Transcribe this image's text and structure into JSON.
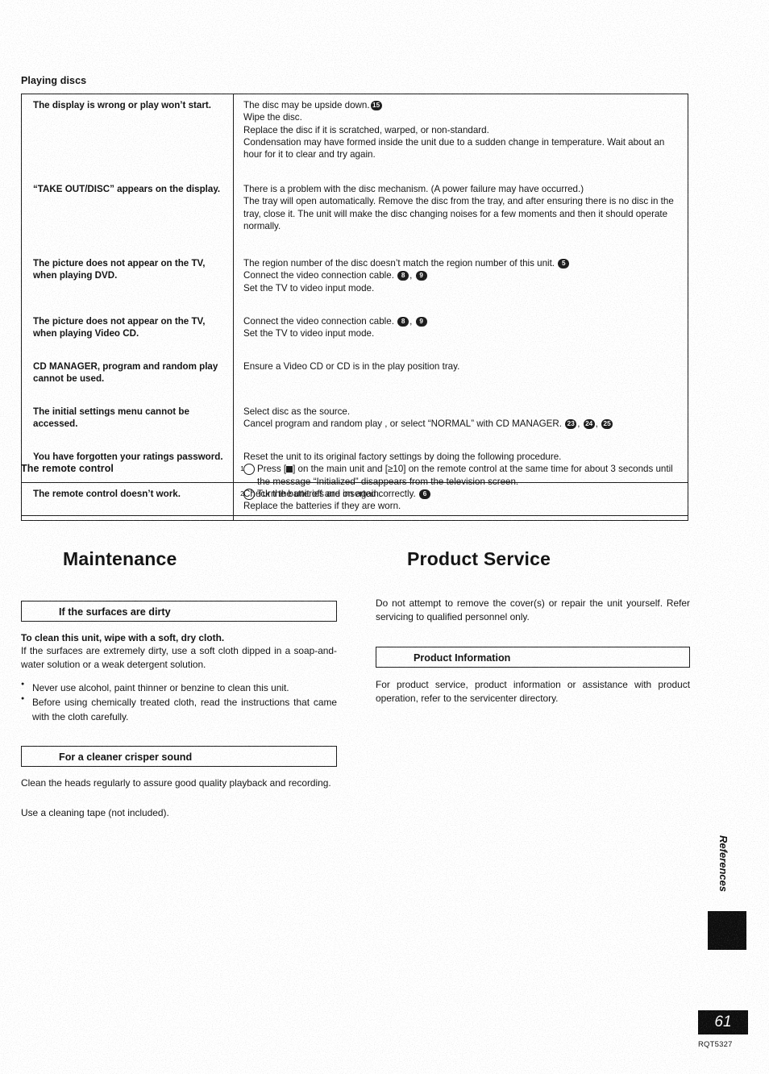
{
  "document": {
    "page_number": "61",
    "doc_code": "RQT5327",
    "side_tab_label": "References"
  },
  "troubleshooting": {
    "playing_discs": {
      "heading": "Playing discs",
      "rows": [
        {
          "symptom": "The display is wrong or play won’t start.",
          "remedies": [
            {
              "text": "The disc may be upside down.",
              "ref": "15"
            },
            {
              "text": "Wipe the disc."
            },
            {
              "text": "Replace the disc if it is scratched, warped, or non-standard."
            },
            {
              "text": "Condensation may have formed inside the unit due to a sudden change in temperature. Wait about an hour for it to clear and try again."
            }
          ]
        },
        {
          "symptom": "“TAKE OUT/DISC” appears on the display.",
          "remedies": [
            {
              "text": "There is a problem with the disc mechanism. (A power failure may have occurred.)"
            },
            {
              "text": "The tray will open automatically. Remove the disc from the tray, and after ensuring there is no disc in the tray, close it. The unit will make the disc changing noises for a few moments and then it should operate normally."
            }
          ]
        },
        {
          "symptom": "The picture does not appear on the TV, when playing DVD.",
          "remedies": [
            {
              "text": "The region number of the disc doesn’t match the region number of this unit.",
              "ref": "5",
              "underline": true
            },
            {
              "text": "Connect the video connection cable.",
              "ref": "8",
              "ref2": "9"
            },
            {
              "text": "Set the TV to video input mode."
            }
          ]
        },
        {
          "symptom": "The picture does not appear on the TV, when playing Video CD.",
          "remedies": [
            {
              "text": "Connect the video connection cable.",
              "ref": "8",
              "ref2": "9"
            },
            {
              "text": "Set the TV to video input mode."
            }
          ]
        },
        {
          "symptom": "CD MANAGER, program and random play cannot be used.",
          "remedies": [
            {
              "text": "Ensure a Video CD or CD is in the play position tray."
            }
          ]
        },
        {
          "symptom": "The initial settings menu cannot be accessed.",
          "remedies": [
            {
              "text": "Select disc as the source."
            },
            {
              "text": "Cancel program  and random play , or select “NORMAL” with CD MANAGER.",
              "ref": "23",
              "ref2": "24",
              "ref3": "25"
            }
          ]
        },
        {
          "symptom": "You have forgotten your ratings password.",
          "remedies": [
            {
              "text": "Reset the unit to its original factory settings by doing the following procedure."
            },
            {
              "num": "1",
              "text_before": "Press [",
              "key": "square-stop",
              "text_after": "] on the main unit and [≥10] on the remote control at the same time for about 3 seconds until the message “Initialized” disappears from the television screen."
            },
            {
              "num": "2",
              "text": "Turn the unit off and on again."
            }
          ]
        }
      ]
    },
    "remote_control": {
      "heading": "The remote control",
      "rows": [
        {
          "symptom": "The remote control doesn’t work.",
          "remedies": [
            {
              "text": "Check the batteries are inserted correctly.",
              "ref": "6"
            },
            {
              "text": "Replace the batteries if they are worn."
            }
          ]
        }
      ]
    }
  },
  "maintenance": {
    "title": "Maintenance",
    "sections": [
      {
        "box_title": "If the surfaces are dirty",
        "lead": "To clean this unit, wipe with a soft, dry cloth.",
        "body": "If the surfaces are extremely dirty, use a soft cloth dipped in a soap-and-water solution or a weak detergent solution.",
        "bullets": [
          "Never use alcohol, paint thinner or benzine to clean this unit.",
          "Before using chemically treated cloth, read the instructions that came with the cloth carefully."
        ]
      },
      {
        "box_title": "For a cleaner crisper sound",
        "body_lines": [
          "Clean the heads regularly to assure good quality playback and recording.",
          "Use a cleaning tape (not included)."
        ]
      }
    ]
  },
  "product_service": {
    "title": "Product Service",
    "intro": "Do not attempt to remove the cover(s) or repair the unit yourself. Refer servicing to qualified personnel only.",
    "box_title": "Product Information",
    "body": "For product service, product information or assistance with product operation, refer to the servicenter directory."
  }
}
